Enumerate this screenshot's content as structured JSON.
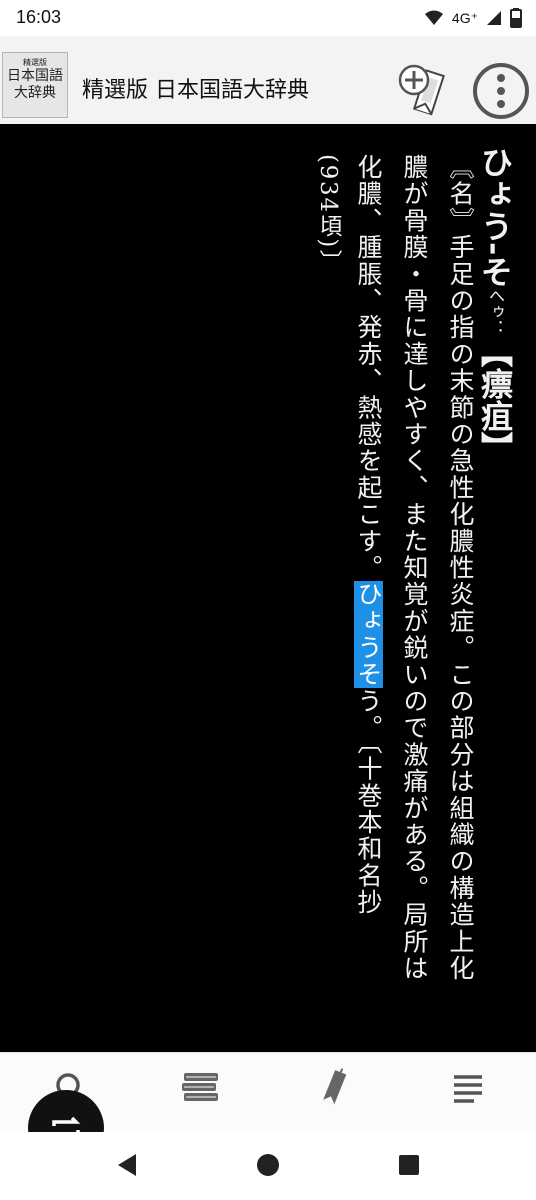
{
  "status_bar": {
    "time": "16:03",
    "network": "4G⁺"
  },
  "app": {
    "title": "精選版 日本国語大辞典",
    "logo_line1": "精選版",
    "logo_line2": "日本国語",
    "logo_line3": "大辞典"
  },
  "entry": {
    "headword": "ひょう-そ",
    "reading": "へゥ：",
    "kanji": "【瘭疽】",
    "col1_before": "〘名〙手足の指の末節の急性化膿性炎症。この部分は組織の構造上化",
    "col2": "膿が骨膜・骨に達しやすく、また知覚が鋭いので激痛がある。局所は",
    "col3_before": "化膿、腫脹、発赤、熱感を起こす。",
    "col3_highlight": "ひょうそ",
    "col3_after": "う。〔十巻本和名抄",
    "col4": "(934頃)〕"
  },
  "icons": {
    "bookmark_add": "bookmark-add-icon",
    "more": "more-vert-icon",
    "search": "search-icon",
    "books": "books-icon",
    "bookmark": "bookmark-icon",
    "menu": "menu-icon",
    "swap": "swap-icon"
  },
  "colors": {
    "highlight": "#1e90e6",
    "background": "#000000"
  }
}
